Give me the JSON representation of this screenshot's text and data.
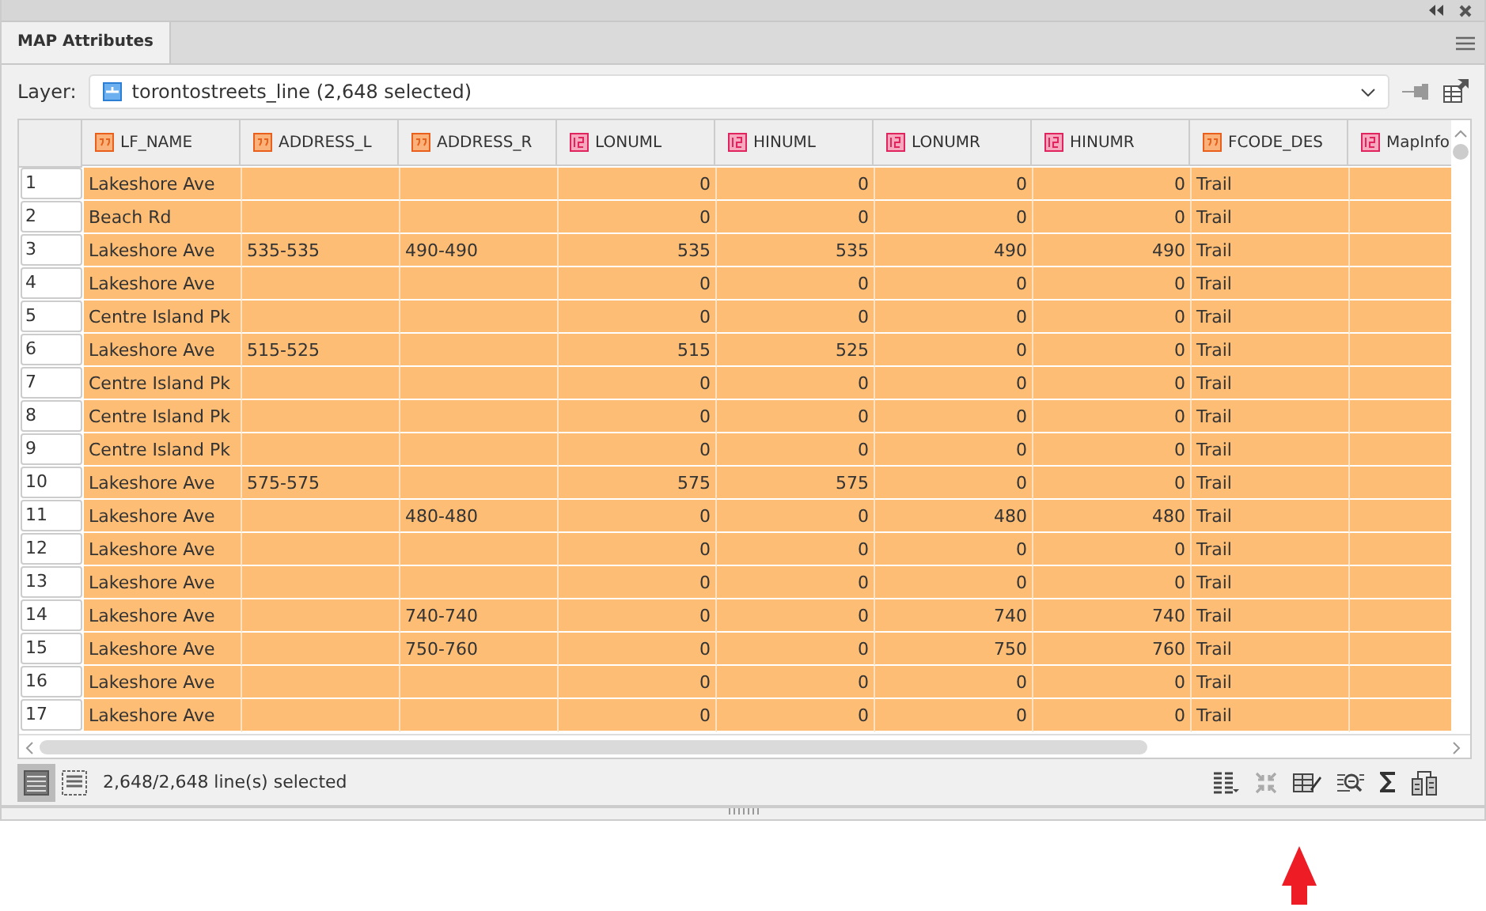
{
  "panel": {
    "title": "MAP Attributes"
  },
  "layer": {
    "label": "Layer:",
    "value": "torontostreets_line (2,648 selected)"
  },
  "table": {
    "columns": [
      {
        "name": "LF_NAME",
        "kind": "text"
      },
      {
        "name": "ADDRESS_L",
        "kind": "text"
      },
      {
        "name": "ADDRESS_R",
        "kind": "text"
      },
      {
        "name": "LONUML",
        "kind": "number"
      },
      {
        "name": "HINUML",
        "kind": "number"
      },
      {
        "name": "LONUMR",
        "kind": "number"
      },
      {
        "name": "HINUMR",
        "kind": "number"
      },
      {
        "name": "FCODE_DES",
        "kind": "text"
      },
      {
        "name": "MapInfo",
        "kind": "number"
      }
    ],
    "rows": [
      {
        "number": "1",
        "selected": true,
        "cells": [
          "Lakeshore Ave",
          null,
          null,
          "0",
          "0",
          "0",
          "0",
          "Trail",
          null
        ]
      },
      {
        "number": "2",
        "selected": true,
        "cells": [
          "Beach Rd",
          null,
          null,
          "0",
          "0",
          "0",
          "0",
          "Trail",
          null
        ]
      },
      {
        "number": "3",
        "selected": true,
        "cells": [
          "Lakeshore Ave",
          "535-535",
          "490-490",
          "535",
          "535",
          "490",
          "490",
          "Trail",
          null
        ]
      },
      {
        "number": "4",
        "selected": true,
        "cells": [
          "Lakeshore Ave",
          null,
          null,
          "0",
          "0",
          "0",
          "0",
          "Trail",
          null
        ]
      },
      {
        "number": "5",
        "selected": true,
        "cells": [
          "Centre Island Pk",
          null,
          null,
          "0",
          "0",
          "0",
          "0",
          "Trail",
          null
        ]
      },
      {
        "number": "6",
        "selected": true,
        "cells": [
          "Lakeshore Ave",
          "515-525",
          null,
          "515",
          "525",
          "0",
          "0",
          "Trail",
          null
        ]
      },
      {
        "number": "7",
        "selected": true,
        "cells": [
          "Centre Island Pk",
          null,
          null,
          "0",
          "0",
          "0",
          "0",
          "Trail",
          null
        ]
      },
      {
        "number": "8",
        "selected": true,
        "cells": [
          "Centre Island Pk",
          null,
          null,
          "0",
          "0",
          "0",
          "0",
          "Trail",
          null
        ]
      },
      {
        "number": "9",
        "selected": true,
        "cells": [
          "Centre Island Pk",
          null,
          null,
          "0",
          "0",
          "0",
          "0",
          "Trail",
          null
        ]
      },
      {
        "number": "10",
        "selected": true,
        "cells": [
          "Lakeshore Ave",
          "575-575",
          null,
          "575",
          "575",
          "0",
          "0",
          "Trail",
          null
        ]
      },
      {
        "number": "11",
        "selected": true,
        "cells": [
          "Lakeshore Ave",
          null,
          "480-480",
          "0",
          "0",
          "480",
          "480",
          "Trail",
          null
        ]
      },
      {
        "number": "12",
        "selected": true,
        "cells": [
          "Lakeshore Ave",
          null,
          null,
          "0",
          "0",
          "0",
          "0",
          "Trail",
          null
        ]
      },
      {
        "number": "13",
        "selected": true,
        "cells": [
          "Lakeshore Ave",
          null,
          null,
          "0",
          "0",
          "0",
          "0",
          "Trail",
          null
        ]
      },
      {
        "number": "14",
        "selected": true,
        "cells": [
          "Lakeshore Ave",
          null,
          "740-740",
          "0",
          "0",
          "740",
          "740",
          "Trail",
          null
        ]
      },
      {
        "number": "15",
        "selected": true,
        "cells": [
          "Lakeshore Ave",
          null,
          "750-760",
          "0",
          "0",
          "750",
          "760",
          "Trail",
          null
        ]
      },
      {
        "number": "16",
        "selected": true,
        "cells": [
          "Lakeshore Ave",
          null,
          null,
          "0",
          "0",
          "0",
          "0",
          "Trail",
          null
        ]
      },
      {
        "number": "17",
        "selected": true,
        "cells": [
          "Lakeshore Ave",
          null,
          null,
          "0",
          "0",
          "0",
          "0",
          "Trail",
          null
        ]
      }
    ]
  },
  "status_bar": {
    "text": "2,648/2,648 line(s) selected"
  }
}
